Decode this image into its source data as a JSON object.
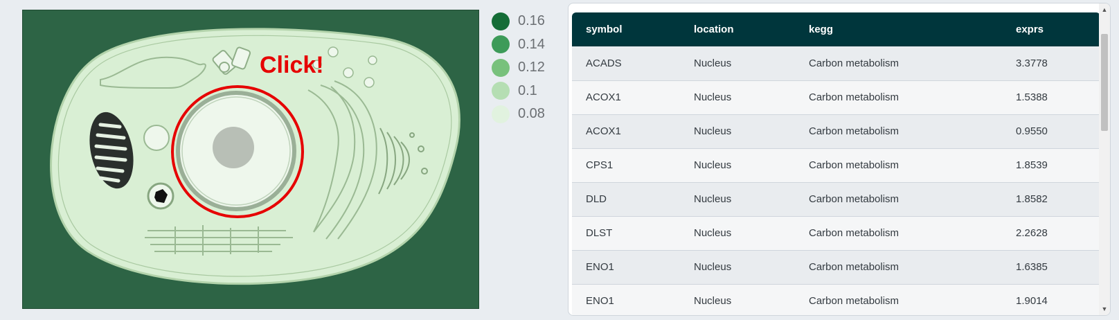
{
  "cell_view": {
    "callout_text": "Click!"
  },
  "legend": {
    "items": [
      {
        "label": "0.16",
        "color": "#146c36"
      },
      {
        "label": "0.14",
        "color": "#3d9b59"
      },
      {
        "label": "0.12",
        "color": "#78c17c"
      },
      {
        "label": "0.1",
        "color": "#b5deb3"
      },
      {
        "label": "0.08",
        "color": "#e1f2df"
      }
    ]
  },
  "table": {
    "columns": [
      "symbol",
      "location",
      "kegg",
      "exprs"
    ],
    "rows": [
      {
        "symbol": "ACADS",
        "location": "Nucleus",
        "kegg": "Carbon metabolism",
        "exprs": "3.3778"
      },
      {
        "symbol": "ACOX1",
        "location": "Nucleus",
        "kegg": "Carbon metabolism",
        "exprs": "1.5388"
      },
      {
        "symbol": "ACOX1",
        "location": "Nucleus",
        "kegg": "Carbon metabolism",
        "exprs": "0.9550"
      },
      {
        "symbol": "CPS1",
        "location": "Nucleus",
        "kegg": "Carbon metabolism",
        "exprs": "1.8539"
      },
      {
        "symbol": "DLD",
        "location": "Nucleus",
        "kegg": "Carbon metabolism",
        "exprs": "1.8582"
      },
      {
        "symbol": "DLST",
        "location": "Nucleus",
        "kegg": "Carbon metabolism",
        "exprs": "2.2628"
      },
      {
        "symbol": "ENO1",
        "location": "Nucleus",
        "kegg": "Carbon metabolism",
        "exprs": "1.6385"
      },
      {
        "symbol": "ENO1",
        "location": "Nucleus",
        "kegg": "Carbon metabolism",
        "exprs": "1.9014"
      }
    ]
  },
  "colors": {
    "header_bg": "#00363c",
    "panel_bg": "#2d6445",
    "callout": "#e60000"
  },
  "icons": {
    "scroll_up": "▲",
    "scroll_down": "▼"
  }
}
